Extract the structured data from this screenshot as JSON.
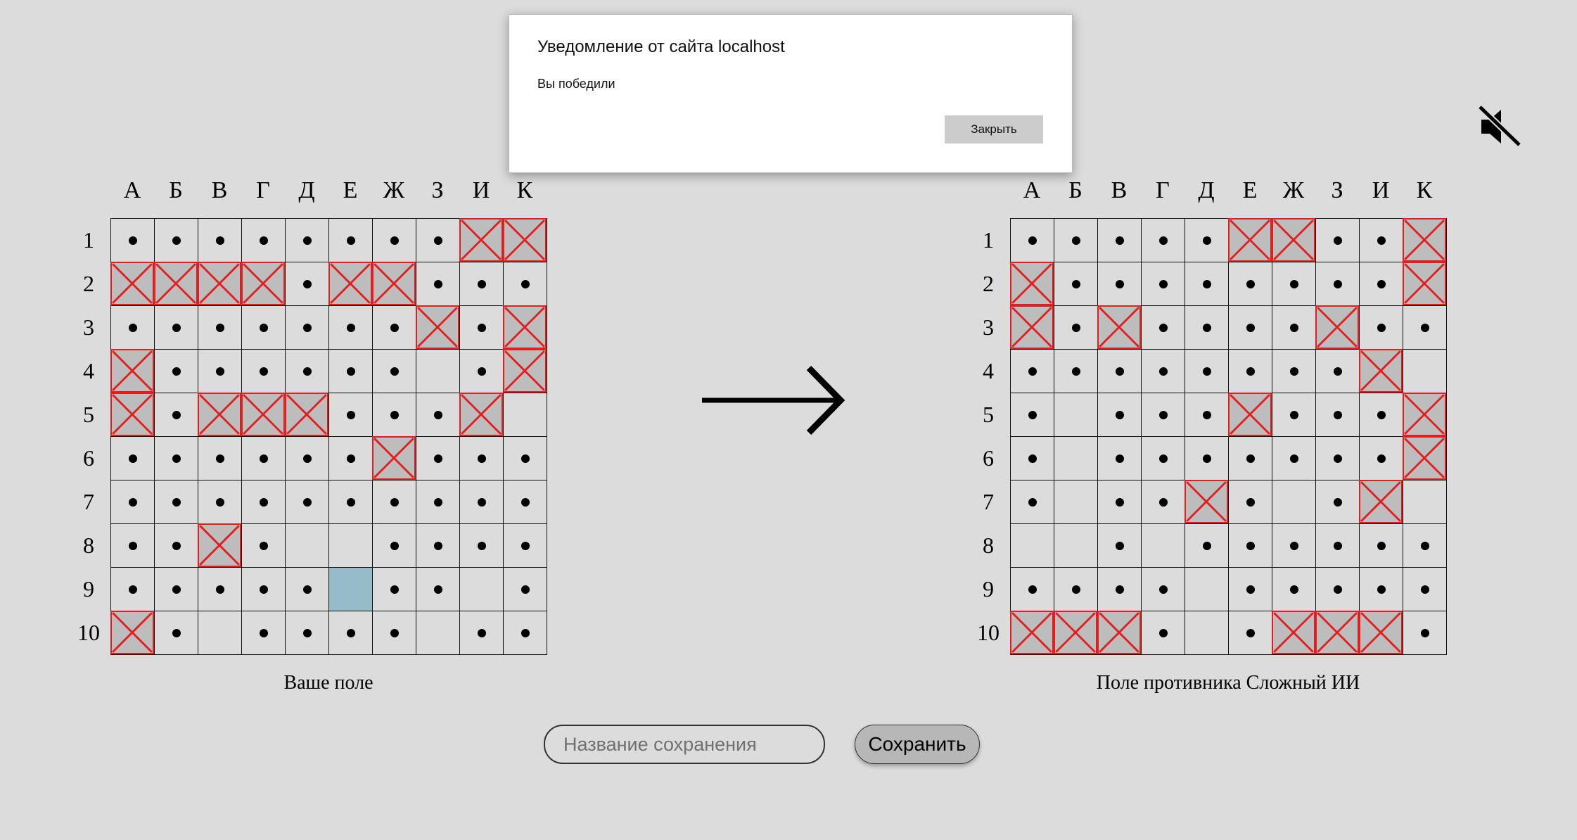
{
  "dialog": {
    "title": "Уведомление от сайта localhost",
    "message": "Вы победили",
    "close_label": "Закрыть"
  },
  "columns": [
    "А",
    "Б",
    "В",
    "Г",
    "Д",
    "Е",
    "Ж",
    "З",
    "И",
    "К"
  ],
  "rows": [
    "1",
    "2",
    "3",
    "4",
    "5",
    "6",
    "7",
    "8",
    "9",
    "10"
  ],
  "cell_legend": {
    "o": "miss",
    "x": "hit",
    "s": "ship",
    ".": "empty"
  },
  "player_board": {
    "caption": "Ваше поле",
    "cells": [
      "ooooooooxx",
      "xxxxoxxooo",
      "oooooooxox",
      "xoooooo.ox",
      "xoxxxooox",
      "ooooooxooo",
      "oooooooooo",
      "ooxo..oooo",
      "ooooosoo.oo",
      "xo.oooo.oo"
    ]
  },
  "enemy_board": {
    "caption": "Поле противника Сложный ИИ",
    "cells": [
      "oooooxxoox",
      "xooooooooх",
      "xoxooooxoo",
      "oooooooox",
      "o.oooxooox",
      "o.ooooooox",
      "o.oox o.ox",
      "..o.oooooo",
      "oooo.ooooo",
      "xxxo.oxxxo"
    ]
  },
  "icons": {
    "arrow": "arrow-right-icon",
    "mute": "sound-muted-icon",
    "hit_mark": "cross-icon",
    "miss_mark": "dot-icon"
  },
  "save": {
    "placeholder": "Название сохранения",
    "button_label": "Сохранить"
  },
  "colors": {
    "background": "#dcdcdc",
    "hit_cross": "#e02020",
    "hit_fill": "#bdbdbd",
    "ship_fill": "#96bcc9"
  }
}
